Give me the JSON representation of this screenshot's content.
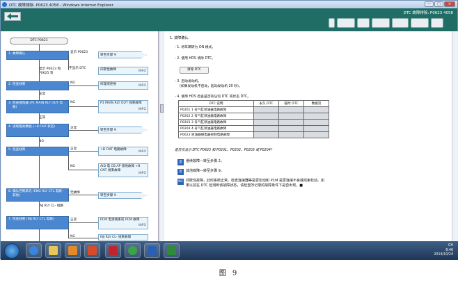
{
  "window": {
    "title": "DTC 故障排除: P0623 4058 - Windows Internet Explorer",
    "buttons": [
      "—",
      "□",
      "✕"
    ]
  },
  "header": {
    "dtc_title": "DTC 故障排除: P0623 4058"
  },
  "flow": {
    "start": "DTC P0623",
    "steps": [
      {
        "n": "1.",
        "text": "故障确认"
      },
      {
        "n": "2.",
        "text": "检查线束"
      },
      {
        "n": "3.",
        "text": "检查继电器 (P1 MAIN RLY OUT 电路)"
      },
      {
        "n": "4.",
        "text": "读取相关数据 (+B CNT 状态)"
      },
      {
        "n": "5.",
        "text": "检查线束"
      },
      {
        "n": "6.",
        "text": "确认控制单元 (ENG RLY CTL 电路 - 其他)"
      },
      {
        "n": "7.",
        "text": "检查线束 (INJ RLY CTL 电路)"
      }
    ],
    "labels": {
      "show_p0623": "显示 P0623",
      "not_show": "不显示 DTC",
      "show_p0623_other": "显示 P0623 和 P0625 等",
      "ok": "正常",
      "ng": "NG",
      "no_fault": "无故障",
      "inj_rly_ctl": "INJ RLY CL- 短路"
    },
    "arrows": [
      "转至步骤 9",
      "转至步骤 9",
      "转至步骤 9",
      "转至步骤 9"
    ],
    "results": [
      {
        "text": "间歇性故障",
        "tag": "INFO"
      },
      {
        "text": "修理或更换",
        "tag": "INFO"
      },
      {
        "text": "P1 MAIN RLY OUT 线束故障",
        "tag": "INFO"
      },
      {
        "text": "+B CNT 电路故障",
        "tag": "INFO"
      },
      {
        "text": "AID 电 CB AP 接地故障 +B CNT 线束故障",
        "tag": "INFO"
      },
      {
        "text": "PCM 电源线束或 PCM 故障",
        "tag": "INFO"
      },
      {
        "text": "INJ RLY CL- 线束故障",
        "tag": "INFO"
      }
    ]
  },
  "content": {
    "heading": "1.  故障确认:",
    "step1": "-  1. 将车辆转为 ON 模式。",
    "step2": "-  2. 使用 HDS 清除 DTC。",
    "clear_button": "清除 DTC",
    "step3": "-  3. 启动发动机。",
    "step3_note": "(如果发动机不启动，起动发动机 20 秒)。",
    "step4": "-  4. 使用 HDS 检查是否有任何 DTC 或状态 DTC。",
    "table": {
      "headers": [
        "DTC 说明",
        "永久 DTC",
        "临时 DTC",
        "数据流"
      ],
      "rows": [
        "P0201 1 号气缸喷油器电路故障",
        "P0202 2 号气缸喷油器电路故障",
        "P0203 3 号气缸喷油器电路故障",
        "P0204 4 号气缸喷油器电路故障",
        "P0623 喷油器继电器控制电路故障"
      ]
    },
    "note": "是否仅显示 DTC P0623 和 P0201、P0202、P0203 或 P0204?",
    "options": [
      {
        "badge": "是",
        "text": "继续故障—转至步骤 2。"
      },
      {
        "badge": "否",
        "text": "其他故障—转至步骤 9。"
      },
      {
        "badge": "NG",
        "text": "间歇性故障，此时系统正常。检查连接器等是否松动和 PCM 是否连接不良或线束松动。如果以前在 DTC 检测到该故障状态，请检查所记录的故障条件下是否出现。■"
      }
    ]
  },
  "taskbar": {
    "lang": "CH",
    "time": "8:46",
    "date": "2014/10/24"
  },
  "caption": "图 9"
}
